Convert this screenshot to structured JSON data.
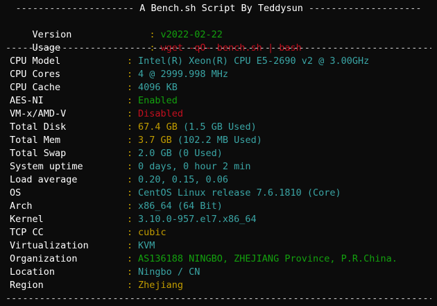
{
  "header": {
    "title": "A Bench.sh Script By Teddysun",
    "dashes_left": "---------------------",
    "dashes_right": "--------------------"
  },
  "separator": "------------------------------------------------------------------------------------------------------------------------",
  "colon": ":",
  "colors": {
    "background": "#0c0c0c",
    "label": "#ffffff",
    "colon": "#c19c00",
    "cyan": "#3aa5a5",
    "green": "#13a10e",
    "red": "#c50f1f",
    "yellow": "#c19c00"
  },
  "info": {
    "version": {
      "label": "Version",
      "value": "v2022-02-22",
      "color": "green"
    },
    "usage": {
      "label": "Usage",
      "value": "wget -qO- bench.sh | bash",
      "color": "red"
    }
  },
  "system": [
    {
      "label": "CPU Model",
      "value": "Intel(R) Xeon(R) CPU E5-2690 v2 @ 3.00GHz",
      "color": "cyan"
    },
    {
      "label": "CPU Cores",
      "value": "4 @ 2999.998 MHz",
      "color": "cyan"
    },
    {
      "label": "CPU Cache",
      "value": "4096 KB",
      "color": "cyan"
    },
    {
      "label": "AES-NI",
      "value": "Enabled",
      "color": "green"
    },
    {
      "label": "VM-x/AMD-V",
      "value": "Disabled",
      "color": "red"
    },
    {
      "label": "Total Disk",
      "value": "67.4 GB",
      "extra": " (1.5 GB Used)",
      "color": "yellow"
    },
    {
      "label": "Total Mem",
      "value": "3.7 GB",
      "extra": " (102.2 MB Used)",
      "color": "yellow"
    },
    {
      "label": "Total Swap",
      "value": "2.0 GB (0 Used)",
      "color": "cyan"
    },
    {
      "label": "System uptime",
      "value": "0 days, 0 hour 2 min",
      "color": "cyan"
    },
    {
      "label": "Load average",
      "value": "0.20, 0.15, 0.06",
      "color": "cyan"
    },
    {
      "label": "OS",
      "value": "CentOS Linux release 7.6.1810 (Core)",
      "color": "cyan"
    },
    {
      "label": "Arch",
      "value": "x86_64 (64 Bit)",
      "color": "cyan"
    },
    {
      "label": "Kernel",
      "value": "3.10.0-957.el7.x86_64",
      "color": "cyan"
    },
    {
      "label": "TCP CC",
      "value": "cubic",
      "color": "yellow"
    },
    {
      "label": "Virtualization",
      "value": "KVM",
      "color": "cyan"
    },
    {
      "label": "Organization",
      "value": "AS136188 NINGBO, ZHEJIANG Province, P.R.China.",
      "color": "green"
    },
    {
      "label": "Location",
      "value": "Ningbo / CN",
      "color": "cyan"
    },
    {
      "label": "Region",
      "value": "Zhejiang",
      "color": "yellow"
    }
  ]
}
